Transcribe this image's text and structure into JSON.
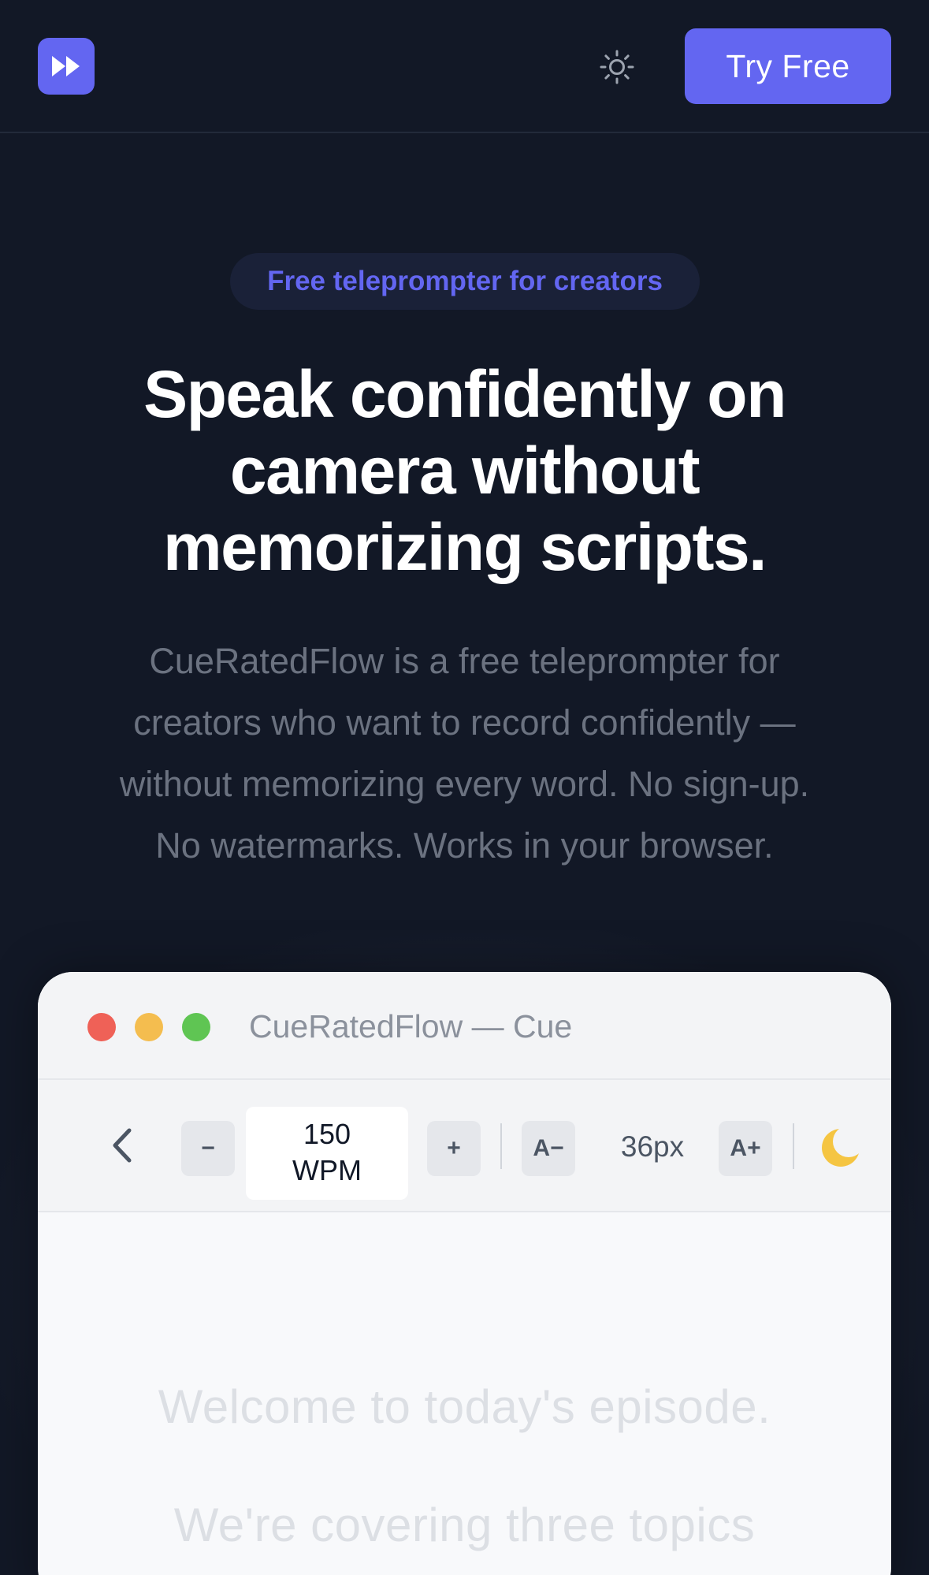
{
  "header": {
    "logo_icon": "fast-forward-icon",
    "theme_icon": "sun-icon",
    "cta_label": "Try Free",
    "accent_color": "#6366f1"
  },
  "hero": {
    "badge": "Free teleprompter for creators",
    "headline_lines": [
      "Speak confidently on",
      "camera without",
      "memorizing scripts."
    ],
    "subtext_lines": [
      "CueRatedFlow is a free teleprompter for",
      "creators who want to record confidently —",
      "without memorizing every word. No sign-up.",
      "No watermarks. Works in your browser."
    ]
  },
  "app_window": {
    "title": "CueRatedFlow — Cue",
    "toolbar": {
      "back_icon": "chevron-left-icon",
      "speed_decrease": "−",
      "speed_value": "150",
      "speed_unit": "WPM",
      "speed_increase": "+",
      "font_decrease": "A−",
      "font_size": "36px",
      "font_increase": "A+",
      "mode_icon": "moon-icon"
    },
    "script_lines": [
      "Welcome to today's episode.",
      "We're covering three topics"
    ]
  }
}
